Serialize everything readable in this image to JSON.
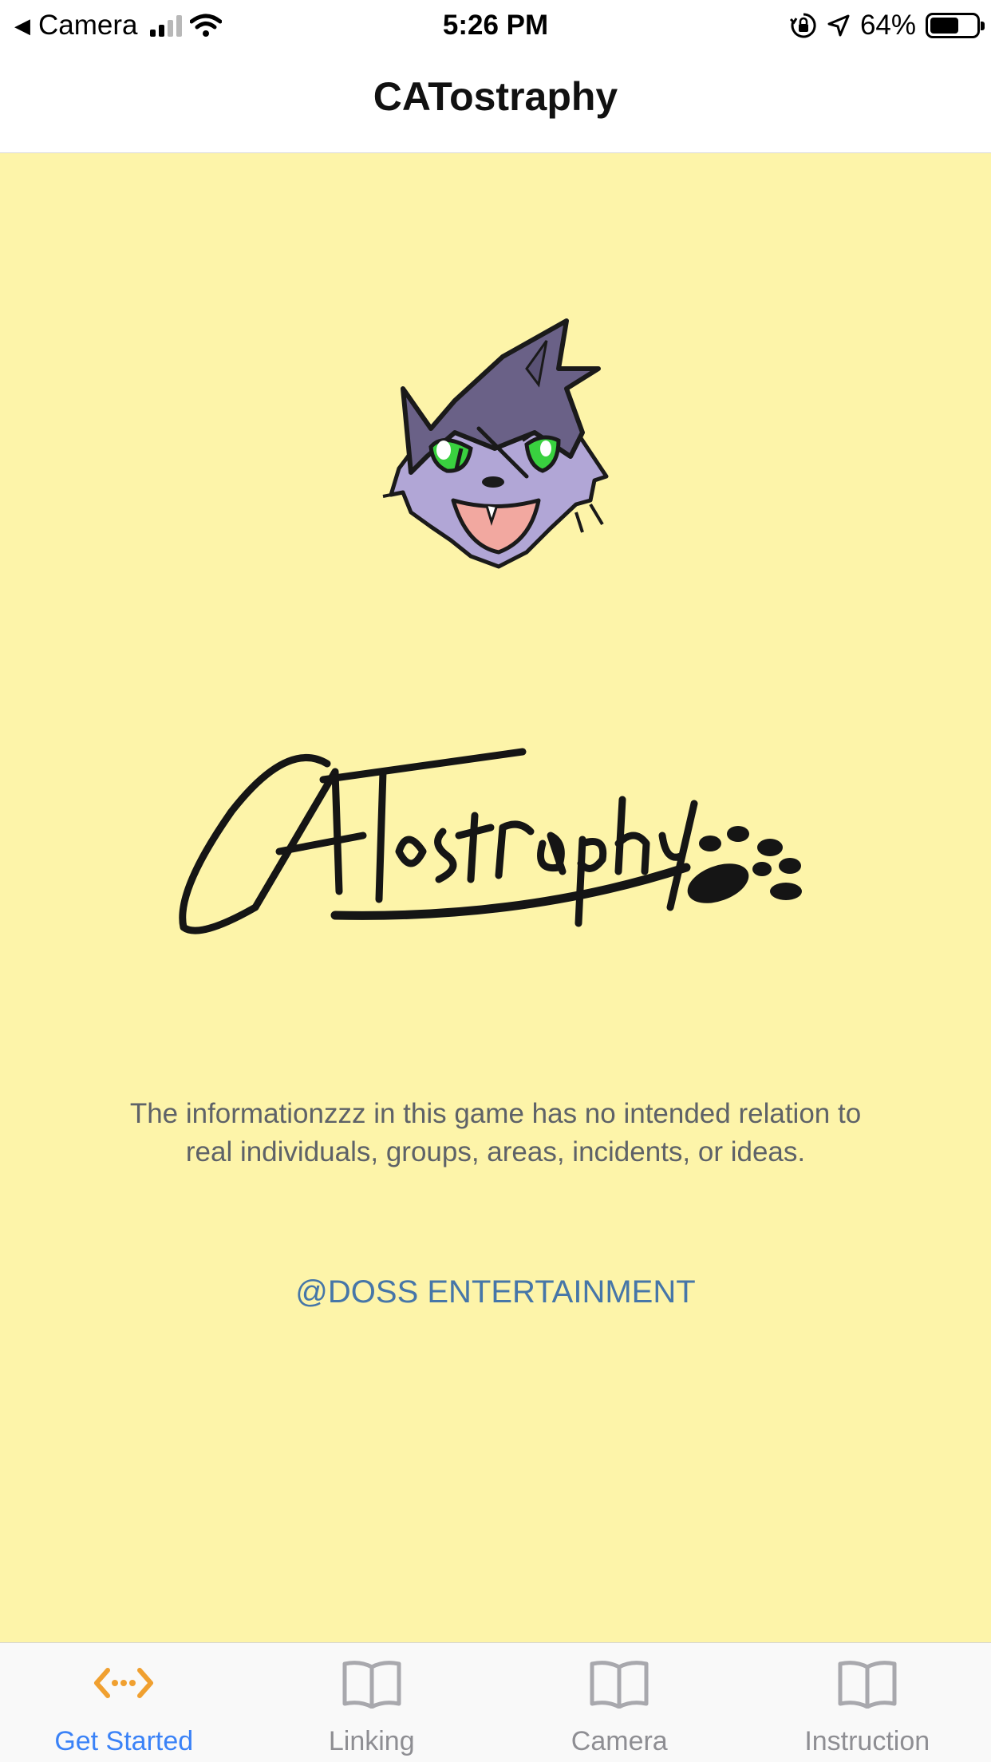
{
  "status_bar": {
    "back_app": "Camera",
    "time": "5:26 PM",
    "battery": "64%"
  },
  "nav": {
    "title": "CATostraphy"
  },
  "main": {
    "logo_text": "CATostraphy",
    "disclaimer": "The informationzzz in this game has no intended relation to real individuals, groups, areas, incidents, or ideas.",
    "credit": "@DOSS ENTERTAINMENT"
  },
  "tab_bar": {
    "tabs": [
      {
        "label": "Get Started",
        "icon": "code-arrows-icon",
        "active": true
      },
      {
        "label": "Linking",
        "icon": "book-icon",
        "active": false
      },
      {
        "label": "Camera",
        "icon": "book-icon",
        "active": false
      },
      {
        "label": "Instruction",
        "icon": "book-icon",
        "active": false
      }
    ]
  },
  "colors": {
    "background": "#fdf4a9",
    "active_tab": "#3a82f7",
    "active_icon": "#f0a030",
    "link": "#4676a8"
  }
}
